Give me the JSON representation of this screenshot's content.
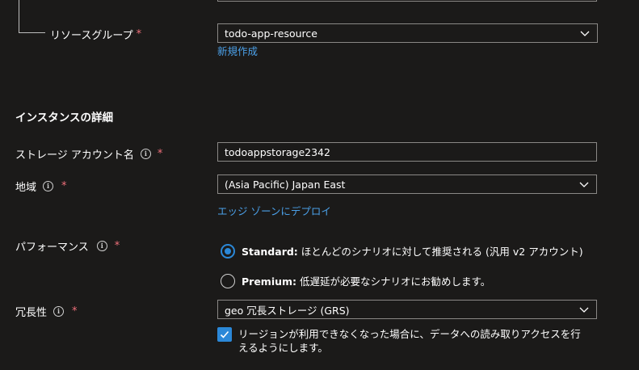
{
  "resource_group": {
    "label": "リソースグループ",
    "required_mark": "*",
    "value": "todo-app-resource",
    "create_new_link": "新規作成"
  },
  "instance_details": {
    "heading": "インスタンスの詳細"
  },
  "storage_account_name": {
    "label": "ストレージ アカウント名",
    "required_mark": "*",
    "value": "todoappstorage2342"
  },
  "region": {
    "label": "地域",
    "required_mark": "*",
    "value": "(Asia Pacific) Japan East",
    "edge_zone_link": "エッジ ゾーンにデプロイ"
  },
  "performance": {
    "label": "パフォーマンス",
    "required_mark": "*",
    "options": [
      {
        "name": "Standard:",
        "desc": "ほとんどのシナリオに対して推奨される (汎用 v2 アカウント)",
        "selected": true
      },
      {
        "name": "Premium:",
        "desc": "低遅延が必要なシナリオにお勧めします。",
        "selected": false
      }
    ]
  },
  "redundancy": {
    "label": "冗長性",
    "required_mark": "*",
    "value": "geo 冗長ストレージ (GRS)",
    "read_access_checkbox": {
      "checked": true,
      "line1": "リージョンが利用できなくなった場合に、データへの読み取りアクセスを行",
      "line2": "えるようにします。"
    }
  },
  "colors": {
    "background": "#1b1a19",
    "link": "#4ba0e8",
    "accent": "#2b88d8",
    "required": "#f1707b",
    "border": "#8a8886"
  },
  "icons": [
    "info-icon",
    "chevron-down-icon",
    "check-icon"
  ]
}
